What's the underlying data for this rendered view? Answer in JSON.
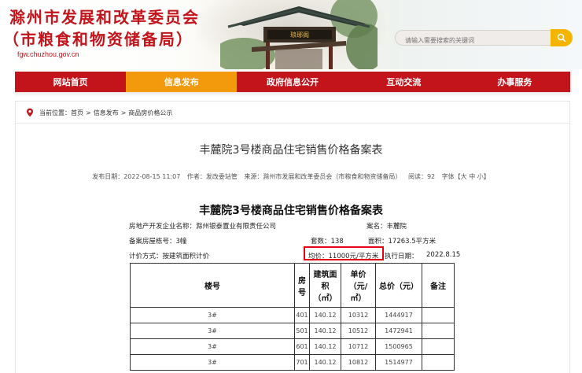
{
  "header": {
    "title_line1": "滁州市发展和改革委员会",
    "title_line2": "（市粮食和物资储备局）",
    "url": "fgw.chuzhou.gov.cn",
    "pavilion_sign": "琅琊阁",
    "search_placeholder": "请输入需要搜索的关键词"
  },
  "nav": {
    "items": [
      {
        "label": "网站首页"
      },
      {
        "label": "信息发布",
        "active": true
      },
      {
        "label": "政府信息公开"
      },
      {
        "label": "互动交流"
      },
      {
        "label": "办事服务"
      }
    ]
  },
  "breadcrumb": {
    "prefix": "当前位置：",
    "items": [
      "首页",
      "信息发布",
      "商品房价格公示"
    ],
    "separator": ">"
  },
  "article": {
    "title": "丰麓院3号楼商品住宅销售价格备案表",
    "meta": {
      "date": "发布日期：2022-08-15 11:07",
      "author": "作者：发改委站管",
      "source": "来源：滁州市发展和改革委员会（市粮食和物资储备局）",
      "views": "阅读：92",
      "font": "字体【大 中 小】"
    }
  },
  "document": {
    "title": "丰麓院3号楼商品住宅销售价格备案表",
    "developer": "房地产开发企业名称：滁州银泰置业有限责任公司",
    "project": "案名：丰麓院",
    "building": "备案房屋栋号：3幢",
    "units": "套数：138",
    "area": "面积：17263.5平方米",
    "pricing_method": "计价方式：按建筑面积计价",
    "avg_price": "均价：11000元/平方米",
    "exec_date_label": "执行日期：",
    "exec_date": "2022.8.15"
  },
  "table": {
    "headers": {
      "building": "楼号",
      "room": "房号",
      "area_line1": "建筑面积",
      "area_line2": "（㎡）",
      "unit_price_line1": "单价",
      "unit_price_line2": "（元/",
      "unit_price_line3": "㎡）",
      "total": "总价（元）",
      "remark": "备注"
    },
    "rows": [
      {
        "building": "3#",
        "room": "401",
        "area": "140.12",
        "unit_price": "10312",
        "total": "1444917",
        "remark": ""
      },
      {
        "building": "3#",
        "room": "501",
        "area": "140.12",
        "unit_price": "10512",
        "total": "1472941",
        "remark": ""
      },
      {
        "building": "3#",
        "room": "601",
        "area": "140.12",
        "unit_price": "10712",
        "total": "1500965",
        "remark": ""
      },
      {
        "building": "3#",
        "room": "701",
        "area": "140.12",
        "unit_price": "10812",
        "total": "1514977",
        "remark": ""
      }
    ]
  },
  "colors": {
    "brand_red": "#c4141b",
    "nav_active": "#f29a0c",
    "search_button": "#f4b400",
    "highlight_border": "#e60012"
  },
  "icons": {
    "breadcrumb": "location-pin-icon",
    "search": "search-icon"
  }
}
